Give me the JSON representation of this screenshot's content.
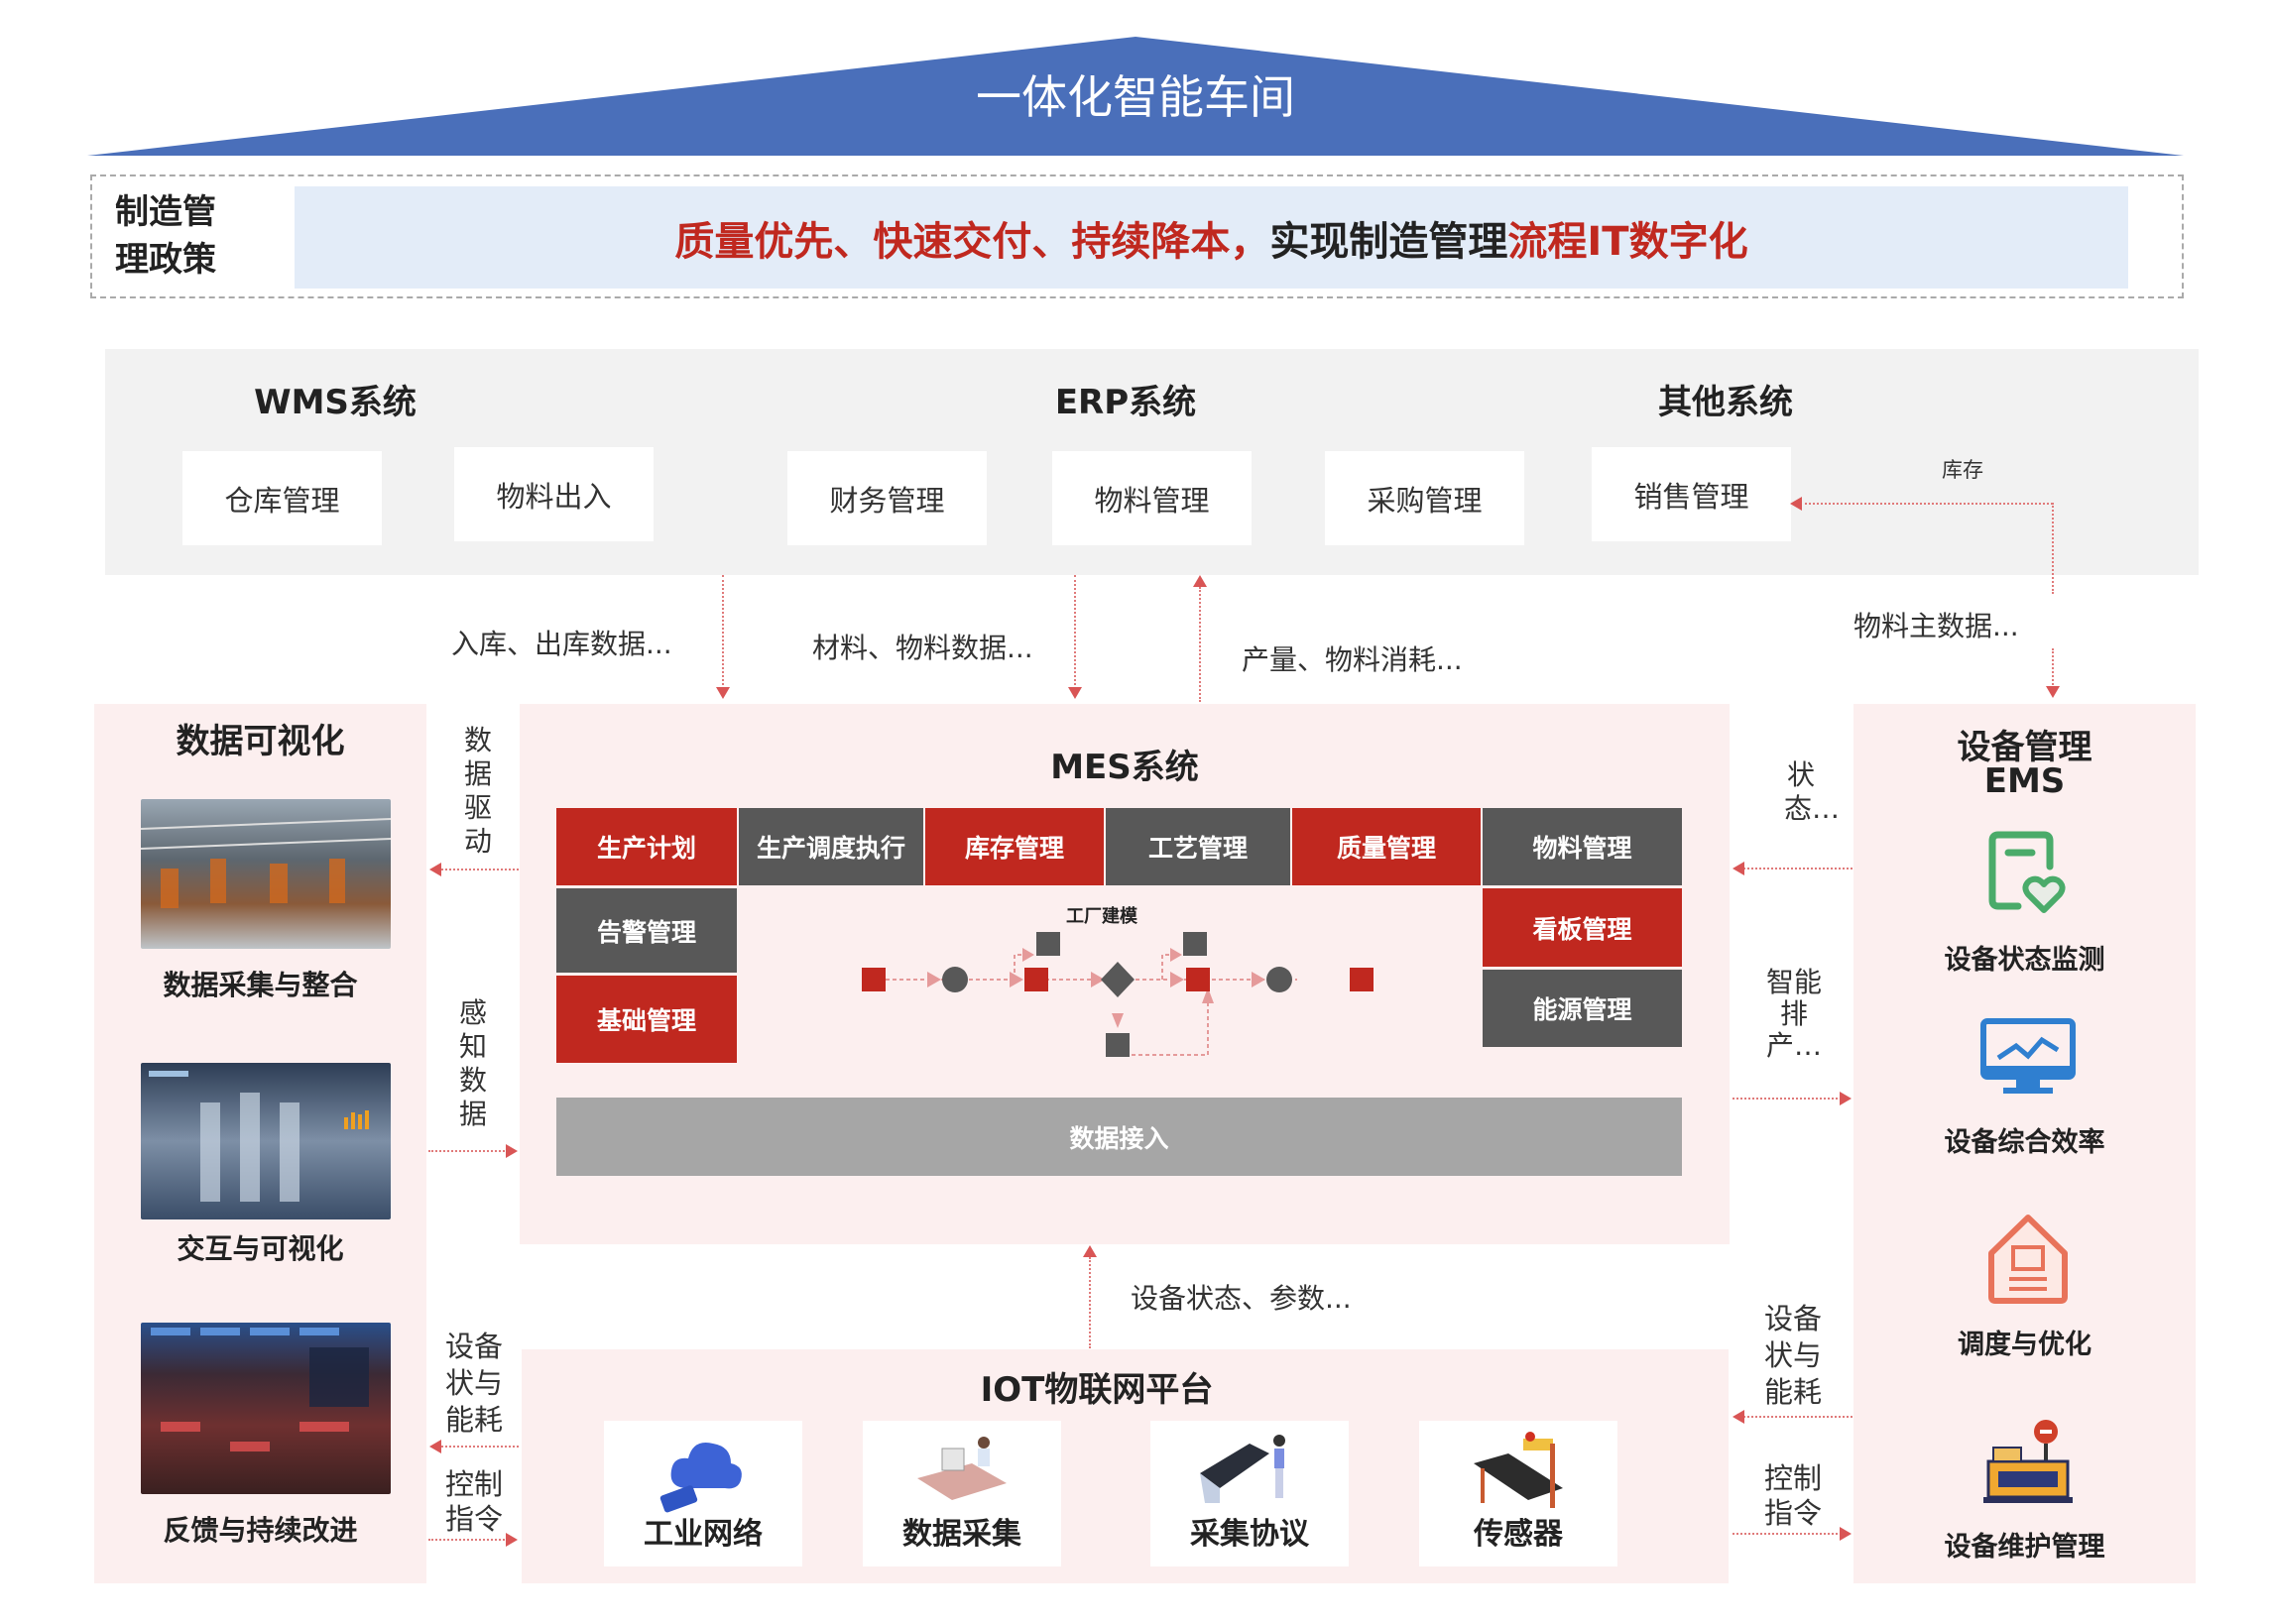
{
  "title": "一体化智能车间",
  "policy": {
    "label": "制造管理政策",
    "slogan_red1": "质量优先、快速交付、持续降本，",
    "slogan_black": "实现制造管理",
    "slogan_red2": "流程IT数字化"
  },
  "systems": {
    "wms": {
      "title": "WMS系统",
      "items": [
        "仓库管理",
        "物料出入"
      ]
    },
    "erp": {
      "title": "ERP系统",
      "items": [
        "财务管理",
        "物料管理",
        "采购管理"
      ]
    },
    "other": {
      "title": "其他系统",
      "items": [
        "销售管理"
      ]
    },
    "inventory_label": "库存"
  },
  "flows": {
    "wms_to_mes": "入库、出库数据...",
    "erp_to_mes": "材料、物料数据...",
    "mes_to_erp": "产量、物料消耗...",
    "to_ems": "物料主数据...",
    "iot_to_mes": "设备状态、参数...",
    "data_driven": "数据驱动",
    "perception": "感知数据",
    "status_energy_left": "设备状与能耗",
    "control_left": "控制指令",
    "status_right": "状态…",
    "scheduling_right": "智能排产…",
    "status_energy_right": "设备状与能耗",
    "control_right": "控制指令"
  },
  "visualization": {
    "title": "数据可视化",
    "items": [
      "数据采集与整合",
      "交互与可视化",
      "反馈与持续改进"
    ]
  },
  "mes": {
    "title": "MES系统",
    "top_modules": [
      "生产计划",
      "生产调度执行",
      "库存管理",
      "工艺管理",
      "质量管理",
      "物料管理"
    ],
    "left_modules": [
      "告警管理",
      "基础管理"
    ],
    "right_modules": [
      "看板管理",
      "能源管理"
    ],
    "factory_model": "工厂建模",
    "data_access": "数据接入"
  },
  "iot": {
    "title": "IOT物联网平台",
    "items": [
      "工业网络",
      "数据采集",
      "采集协议",
      "传感器"
    ]
  },
  "ems": {
    "title": "设备管理",
    "subtitle": "EMS",
    "items": [
      "设备状态监测",
      "设备综合效率",
      "调度与优化",
      "设备维护管理"
    ]
  },
  "colors": {
    "roof": "#4a6fba",
    "red": "#c0281f",
    "gray": "#585858",
    "panel": "#fcefef"
  }
}
